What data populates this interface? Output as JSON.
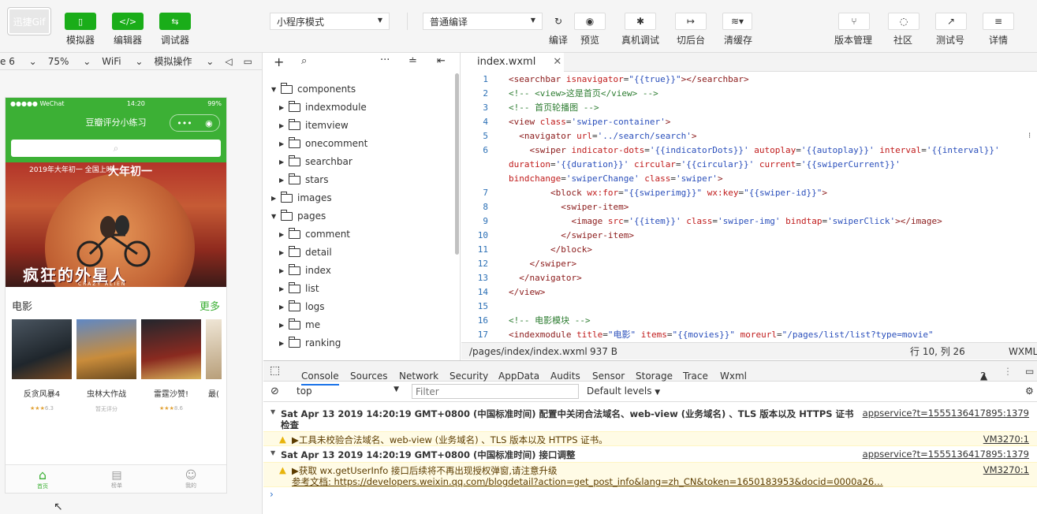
{
  "toolbar": {
    "logo": "迅捷Gif",
    "mode_buttons": [
      {
        "label": "模拟器",
        "icon": "phone-icon"
      },
      {
        "label": "编辑器",
        "icon": "code-icon"
      },
      {
        "label": "调试器",
        "icon": "debug-icon"
      }
    ],
    "mode_select": "小程序模式",
    "compile_select": "普通编译",
    "actions": [
      {
        "label": "编译",
        "icon": "refresh-icon"
      },
      {
        "label": "预览",
        "icon": "eye-icon"
      },
      {
        "label": "真机调试",
        "icon": "bug-icon"
      },
      {
        "label": "切后台",
        "icon": "switch-icon"
      },
      {
        "label": "清缓存",
        "icon": "layers-icon"
      }
    ],
    "right_actions": [
      {
        "label": "版本管理",
        "icon": "branch-icon"
      },
      {
        "label": "社区",
        "icon": "chat-icon"
      },
      {
        "label": "测试号",
        "icon": "external-icon"
      },
      {
        "label": "详情",
        "icon": "menu-icon"
      }
    ]
  },
  "simulator": {
    "device": "e 6",
    "zoom": "75%",
    "network": "WiFi",
    "ops": "模拟操作",
    "phone": {
      "carrier": "●●●●● WeChat",
      "time": "14:20",
      "battery": "99%",
      "title": "豆瓣评分小练习",
      "banner_top": "2019年大年初一 全国上映",
      "banner_head": "大年初一",
      "banner_title": "疯狂的外星人",
      "banner_sub": "CRAZY ALIEN",
      "section_title": "电影",
      "section_more": "更多",
      "movies": [
        {
          "title": "反贪风暴4",
          "rating": "6.3",
          "stars": "★★★"
        },
        {
          "title": "虫林大作战",
          "rating": "暂无评分",
          "stars": ""
        },
        {
          "title": "雷霆沙赞!",
          "rating": "8.6",
          "stars": "★★★"
        },
        {
          "title": "最(",
          "rating": "",
          "stars": ""
        }
      ],
      "tabs": [
        "首页",
        "榜单",
        "我的"
      ]
    }
  },
  "tree": {
    "items": [
      {
        "label": "components",
        "open": true,
        "depth": 0
      },
      {
        "label": "indexmodule",
        "open": false,
        "depth": 1
      },
      {
        "label": "itemview",
        "open": false,
        "depth": 1
      },
      {
        "label": "onecomment",
        "open": false,
        "depth": 1
      },
      {
        "label": "searchbar",
        "open": false,
        "depth": 1
      },
      {
        "label": "stars",
        "open": false,
        "depth": 1
      },
      {
        "label": "images",
        "open": false,
        "depth": 0
      },
      {
        "label": "pages",
        "open": true,
        "depth": 0
      },
      {
        "label": "comment",
        "open": false,
        "depth": 1
      },
      {
        "label": "detail",
        "open": false,
        "depth": 1
      },
      {
        "label": "index",
        "open": false,
        "depth": 1
      },
      {
        "label": "list",
        "open": false,
        "depth": 1
      },
      {
        "label": "logs",
        "open": false,
        "depth": 1
      },
      {
        "label": "me",
        "open": false,
        "depth": 1
      },
      {
        "label": "ranking",
        "open": false,
        "depth": 1
      }
    ]
  },
  "editor": {
    "tab": "index.wxml",
    "lines": [
      "1",
      "2",
      "3",
      "4",
      "5",
      "6",
      "",
      "",
      "7",
      "8",
      "9",
      "10",
      "11",
      "12",
      "13",
      "14",
      "15",
      "16",
      "17"
    ],
    "status_path": "/pages/index/index.wxml",
    "status_size": "937 B",
    "status_pos": "行 10, 列 26",
    "status_lang": "WXML"
  },
  "console": {
    "tabs": [
      "Console",
      "Sources",
      "Network",
      "Security",
      "AppData",
      "Audits",
      "Sensor",
      "Storage",
      "Trace",
      "Wxml"
    ],
    "warn_count": "2",
    "context": "top",
    "filter_placeholder": "Filter",
    "levels": "Default levels",
    "messages": [
      {
        "text": "Sat Apr 13 2019 14:20:19 GMT+0800 (中国标准时间) 配置中关闭合法域名、web-view (业务域名) 、TLS 版本以及 HTTPS 证书",
        "text2": "检查",
        "src": "appservice?t=1555136417895:1379"
      },
      {
        "text": "▶工具未校验合法域名、web-view (业务域名) 、TLS 版本以及 HTTPS 证书。",
        "src": "VM3270:1"
      },
      {
        "text": "Sat Apr 13 2019 14:20:19 GMT+0800 (中国标准时间) 接口调整",
        "src": "appservice?t=1555136417895:1379"
      },
      {
        "text": "▶获取 wx.getUserInfo 接口后续将不再出现授权弹窗,请注意升级",
        "text2": "参考文档: https://developers.weixin.qq.com/blogdetail?action=get_post_info&lang=zh_CN&token=1650183953&docid=0000a26…",
        "src": "VM3270:1"
      }
    ]
  }
}
